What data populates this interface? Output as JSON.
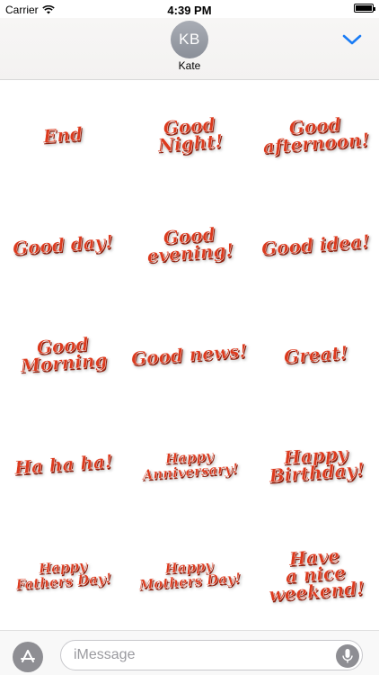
{
  "status_bar": {
    "carrier": "Carrier",
    "time": "4:39 PM",
    "icons": [
      "wifi-icon",
      "battery-icon"
    ],
    "battery_level": 1.0
  },
  "header": {
    "avatar_initials": "KB",
    "contact_name": "Kate",
    "collapse_icon": "chevron-down-icon",
    "accent_color": "#1a7cf5"
  },
  "stickers": [
    {
      "text": "End"
    },
    {
      "text": "Good\nNight!"
    },
    {
      "text": "Good\nafternoon!"
    },
    {
      "text": "Good day!"
    },
    {
      "text": "Good\nevening!"
    },
    {
      "text": "Good idea!"
    },
    {
      "text": "Good\nMorning"
    },
    {
      "text": "Good news!"
    },
    {
      "text": "Great!"
    },
    {
      "text": "Ha ha ha!"
    },
    {
      "text": "Happy\nAnniversary!"
    },
    {
      "text": "Happy\nBirthday!"
    },
    {
      "text": "Happy\nFathers Day!"
    },
    {
      "text": "Happy\nMothers Day!"
    },
    {
      "text": "Have\na nice\nweekend!"
    }
  ],
  "sticker_color": "#dc3a1e",
  "input_bar": {
    "placeholder": "iMessage",
    "left_icon": "app-store-icon",
    "right_icon": "microphone-icon"
  }
}
